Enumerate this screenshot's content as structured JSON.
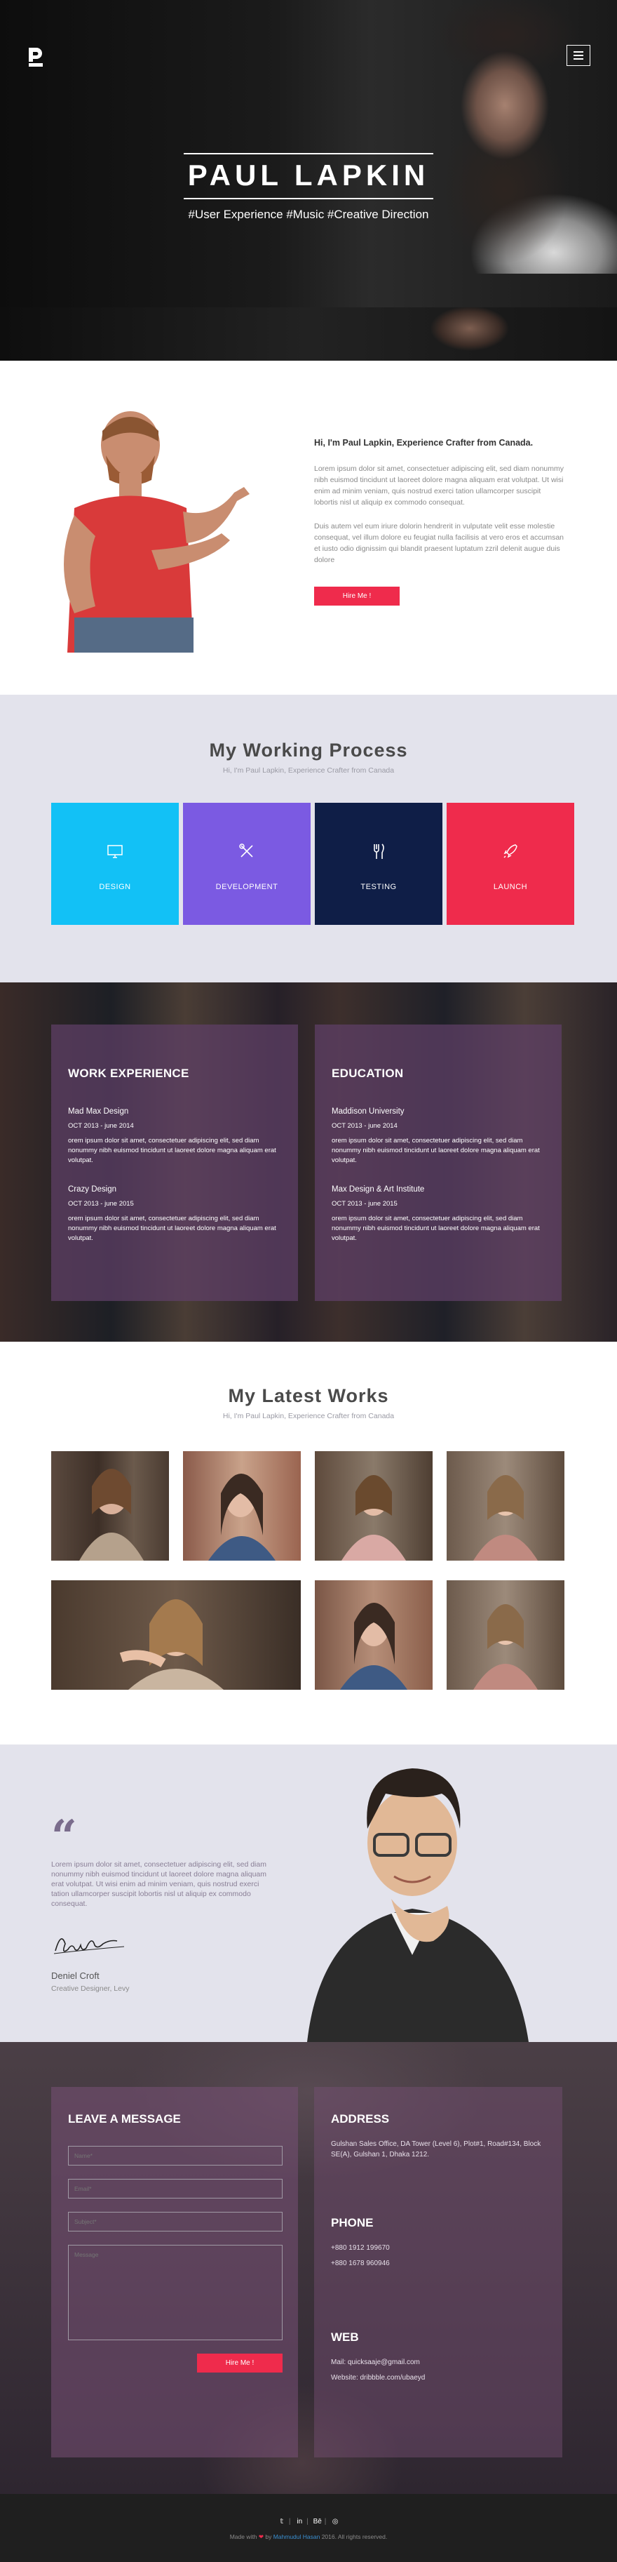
{
  "hero": {
    "name": "PAUL LAPKIN",
    "tags": "#User Experience  #Music  #Creative Direction"
  },
  "about": {
    "heading": "Hi, I'm Paul Lapkin, Experience Crafter from Canada.",
    "para1": "Lorem ipsum dolor sit amet, consectetuer adipiscing elit, sed diam nonummy nibh euismod tincidunt ut laoreet dolore magna aliquam erat volutpat. Ut wisi enim ad minim veniam, quis nostrud exerci tation ullamcorper suscipit lobortis nisl ut aliquip ex commodo consequat.",
    "para2": "Duis autem vel eum iriure dolorin hendrerit in vulputate velit esse molestie consequat, vel illum dolore eu feugiat nulla facilisis at vero eros et accumsan et iusto odio dignissim qui blandit praesent luptatum zzril delenit augue duis dolore",
    "button": "Hire Me !"
  },
  "process": {
    "title": "My Working Process",
    "subtitle": "Hi, I'm Paul Lapkin, Experience Crafter from Canada",
    "cards": [
      {
        "label": "DESIGN",
        "icon": "monitor-icon",
        "color": "#12c1f6"
      },
      {
        "label": "DEVELOPMENT",
        "icon": "tools-icon",
        "color": "#7b5ae2"
      },
      {
        "label": "TESTING",
        "icon": "utensils-icon",
        "color": "#0f1e47"
      },
      {
        "label": "LAUNCH",
        "icon": "rocket-icon",
        "color": "#ef2b4c"
      }
    ]
  },
  "experience": {
    "work_title": "WORK EXPERIENCE",
    "edu_title": "EDUCATION",
    "work": [
      {
        "title": "Mad Max Design",
        "dates": "OCT 2013 - june 2014",
        "desc": "orem ipsum dolor sit amet, consectetuer adipiscing elit, sed diam nonummy nibh euismod tincidunt ut laoreet dolore magna aliquam erat volutpat."
      },
      {
        "title": "Crazy Design",
        "dates": "OCT 2013 - june 2015",
        "desc": "orem ipsum dolor sit amet, consectetuer adipiscing elit, sed diam nonummy nibh euismod tincidunt ut laoreet dolore magna aliquam erat volutpat."
      }
    ],
    "education": [
      {
        "title": "Maddison University",
        "dates": "OCT 2013 - june 2014",
        "desc": "orem ipsum dolor sit amet, consectetuer adipiscing elit, sed diam nonummy nibh euismod tincidunt ut laoreet dolore magna aliquam erat volutpat."
      },
      {
        "title": "Max Design & Art Institute",
        "dates": "OCT 2013 - june 2015",
        "desc": "orem ipsum dolor sit amet, consectetuer adipiscing elit, sed diam nonummy nibh euismod tincidunt ut laoreet dolore magna aliquam erat volutpat."
      }
    ]
  },
  "works": {
    "title": "My Latest Works",
    "subtitle": "Hi, I'm Paul Lapkin, Experience Crafter from Canada"
  },
  "testimonial": {
    "quote": "Lorem ipsum dolor sit amet, consectetuer adipiscing elit, sed diam nonummy nibh euismod tincidunt ut laoreet dolore magna aliquam erat volutpat. Ut wisi enim ad minim veniam, quis nostrud exerci tation ullamcorper suscipit lobortis nisl ut aliquip ex commodo consequat.",
    "name": "Deniel Croft",
    "role": "Creative Designer, Levy"
  },
  "contact": {
    "form_title": "LEAVE A MESSAGE",
    "name_placeholder": "Name*",
    "email_placeholder": "Email*",
    "subject_placeholder": "Subject*",
    "message_placeholder": "Message",
    "submit": "Hire Me !",
    "address_title": "ADDRESS",
    "address": "Gulshan Sales Office, DA Tower (Level 6), Plot#1, Road#134, Block SE(A), Gulshan 1, Dhaka 1212.",
    "phone_title": "PHONE",
    "phone1": "+880 1912 199670",
    "phone2": "+880 1678 960946",
    "web_title": "WEB",
    "mail": "Mail: quicksaaje@gmail.com",
    "website": "Website: dribbble.com/ubaeyd"
  },
  "footer": {
    "made_with": "Made with",
    "by": "by",
    "author": "Mahmudul Hasan",
    "rest": "2016. All rights reserved."
  }
}
